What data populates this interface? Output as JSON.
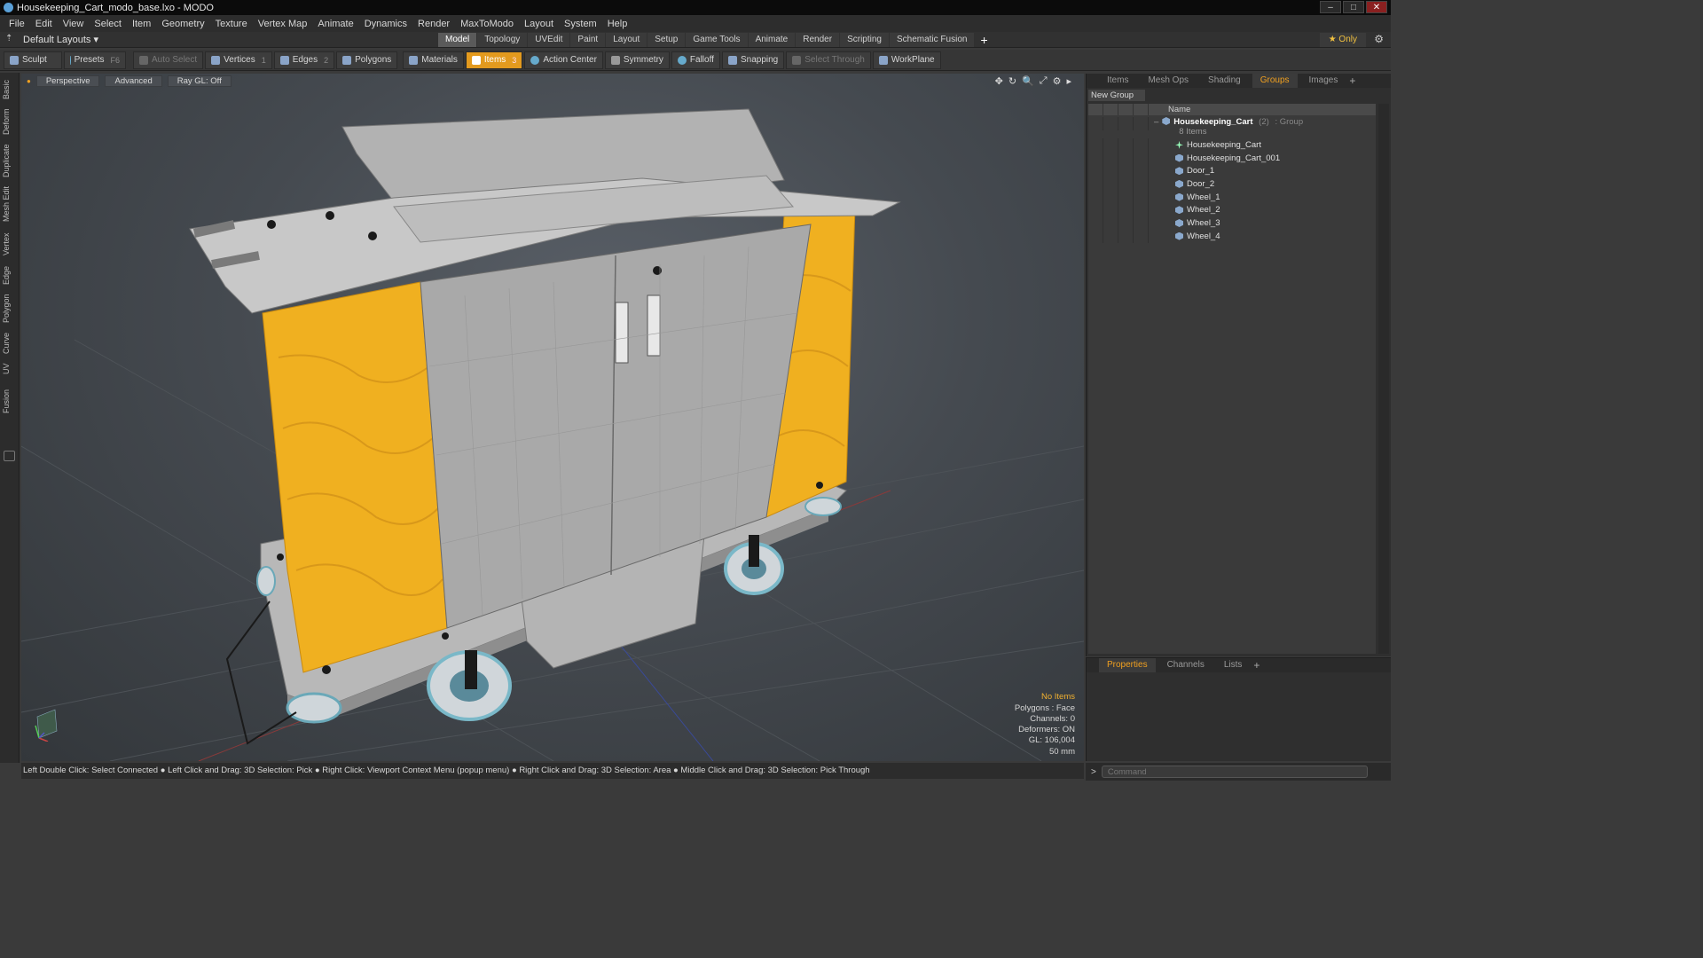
{
  "window": {
    "title": "Housekeeping_Cart_modo_base.lxo - MODO",
    "controls": [
      "–",
      "□",
      "✕"
    ]
  },
  "menu": [
    "File",
    "Edit",
    "View",
    "Select",
    "Item",
    "Geometry",
    "Texture",
    "Vertex Map",
    "Animate",
    "Dynamics",
    "Render",
    "MaxToModo",
    "Layout",
    "System",
    "Help"
  ],
  "layoutbar": {
    "layout_label": "Default Layouts ▾",
    "tabs": [
      "Model",
      "Topology",
      "UVEdit",
      "Paint",
      "Layout",
      "Setup",
      "Game Tools",
      "Animate",
      "Render",
      "Scripting",
      "Schematic Fusion"
    ],
    "active_tab": "Model",
    "plus": "+",
    "only_label": "★ Only",
    "gear": "⚙"
  },
  "toolbar": {
    "sculpt": "Sculpt",
    "presets": "Presets",
    "presets_key": "F6",
    "auto_select": "Auto Select",
    "vertices": "Vertices",
    "vertices_count": "1",
    "edges": "Edges",
    "edges_count": "2",
    "polygons": "Polygons",
    "materials": "Materials",
    "items": "Items",
    "items_count": "3",
    "action_center": "Action Center",
    "symmetry": "Symmetry",
    "falloff": "Falloff",
    "snapping": "Snapping",
    "select_through": "Select Through",
    "workplane": "WorkPlane"
  },
  "left_tabs": [
    "Basic",
    "Deform",
    "Duplicate",
    "Mesh Edit",
    "Vertex",
    "Edge",
    "Polygon",
    "Curve",
    "UV",
    "Fusion"
  ],
  "viewport": {
    "view_mode": "Perspective",
    "shading": "Advanced",
    "raygl": "Ray GL: Off",
    "tools": [
      "✥",
      "↻",
      "🔍",
      "⤢",
      "⚙",
      "▸"
    ],
    "info": {
      "no_items": "No Items",
      "polygons": "Polygons : Face",
      "channels": "Channels: 0",
      "deformers": "Deformers: ON",
      "gl": "GL: 106,004",
      "unit": "50 mm"
    }
  },
  "hint": "Left Double Click: Select Connected ● Left Click and Drag: 3D Selection: Pick ● Right Click: Viewport Context Menu (popup menu) ● Right Click and Drag: 3D Selection: Area ● Middle Click and Drag: 3D Selection: Pick Through",
  "right_panel": {
    "tabs": [
      "Items",
      "Mesh Ops",
      "Shading",
      "Groups",
      "Images"
    ],
    "active_tab": "Groups",
    "new_group": "New Group",
    "name_header": "Name",
    "group": {
      "name": "Housekeeping_Cart",
      "count": "(2)",
      "type": ": Group",
      "items_label": "8 Items"
    },
    "children": [
      "Housekeeping_Cart",
      "Housekeeping_Cart_001",
      "Door_1",
      "Door_2",
      "Wheel_1",
      "Wheel_2",
      "Wheel_3",
      "Wheel_4"
    ]
  },
  "props_panel": {
    "tabs": [
      "Properties",
      "Channels",
      "Lists"
    ],
    "active_tab": "Properties"
  },
  "command": {
    "placeholder": "Command"
  },
  "colors": {
    "accent": "#e39a1e",
    "cart_body": "#9a9a9a",
    "bag_yellow": "#f0b020"
  }
}
